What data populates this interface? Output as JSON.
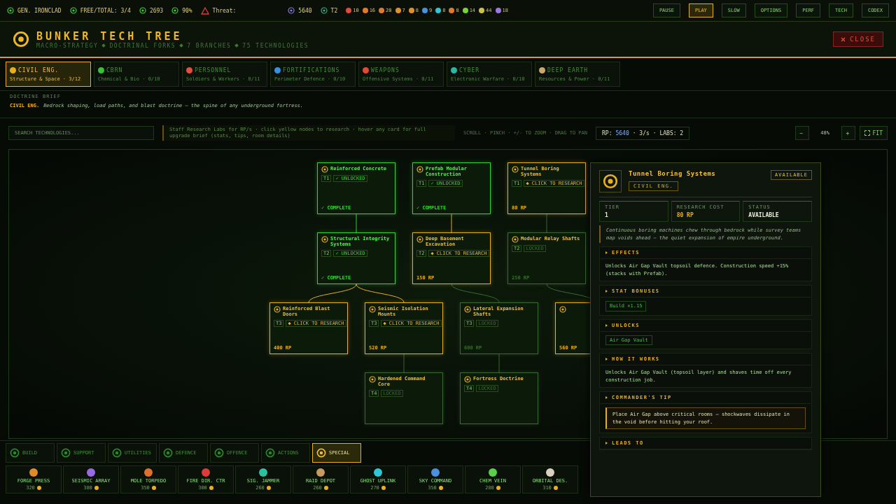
{
  "top_bar": {
    "commander": "GEN. IRONCLAD",
    "workers": "FREE/TOTAL: 3/4",
    "supplies": "2693",
    "power": "90%",
    "threat": "Threat:",
    "research_points": "5640",
    "tier": "T2",
    "resources": [
      {
        "value": "10",
        "color": "#e04a3a"
      },
      {
        "value": "16",
        "color": "#e07a2a"
      },
      {
        "value": "20",
        "color": "#e07a2a"
      },
      {
        "value": "7",
        "color": "#e0902a"
      },
      {
        "value": "8",
        "color": "#e0902a"
      },
      {
        "value": "9",
        "color": "#4a90e0"
      },
      {
        "value": "8",
        "color": "#2ac8d0"
      },
      {
        "value": "8",
        "color": "#e07a2a"
      },
      {
        "value": "14",
        "color": "#7ad03a"
      },
      {
        "value": "44",
        "color": "#d0c04a"
      },
      {
        "value": "18",
        "color": "#9a7ae0"
      }
    ],
    "speed_buttons": [
      {
        "label": "PAUSE",
        "selected": false
      },
      {
        "label": "PLAY",
        "selected": true
      },
      {
        "label": "SLOW",
        "selected": false
      }
    ],
    "menu_buttons": [
      "OPTIONS",
      "PERF",
      "TECH",
      "CODEX"
    ]
  },
  "header": {
    "title": "BUNKER TECH TREE",
    "subtitle": [
      "MACRO-STRATEGY",
      "DOCTRINAL FORKS",
      "7 BRANCHES",
      "75 TECHNOLOGIES"
    ],
    "close": "CLOSE"
  },
  "branches": [
    {
      "name": "CIVIL ENG.",
      "sub": "Structure & Space · 3/12",
      "color": "#e8b020",
      "selected": true
    },
    {
      "name": "CBRN",
      "sub": "Chemical & Bio · 0/10",
      "color": "#3ac03a",
      "selected": false
    },
    {
      "name": "PERSONNEL",
      "sub": "Soldiers & Workers · 0/11",
      "color": "#e05040",
      "selected": false
    },
    {
      "name": "FORTIFICATIONS",
      "sub": "Perimeter Defence · 0/10",
      "color": "#3a90e0",
      "selected": false
    },
    {
      "name": "WEAPONS",
      "sub": "Offensive Systems · 0/11",
      "color": "#e04a3a",
      "selected": false
    },
    {
      "name": "CYBER",
      "sub": "Electronic Warfare · 0/10",
      "color": "#2ab8a0",
      "selected": false
    },
    {
      "name": "DEEP EARTH",
      "sub": "Resources & Power · 0/11",
      "color": "#c8a870",
      "selected": false
    }
  ],
  "brief": {
    "label": "DOCTRINE BRIEF",
    "branch": "CIVIL ENG.",
    "text": "Bedrock shaping, load paths, and blast doctrine — the spine of any underground fortress."
  },
  "toolbar": {
    "search_placeholder": "SEARCH TECHNOLOGIES...",
    "hint": "Staff Research Labs for RP/s · click yellow nodes to research · hover any card for full upgrade brief (stats, tips, room details)",
    "controls": "SCROLL · PINCH · +/- TO ZOOM · DRAG TO PAN",
    "rp_label": "RP:",
    "rp_value": "5640",
    "rp_rate": "· 3/s ·",
    "labs": "LABS: 2",
    "zoom_out": "−",
    "zoom": "48%",
    "zoom_in": "+",
    "fit": "FIT"
  },
  "tree": {
    "tiers": [
      [
        {
          "kind": "researched",
          "title": "Reinforced Concrete",
          "tier": "T1",
          "tag": "✓ UNLOCKED",
          "footer": "✓ COMPLETE"
        },
        {
          "kind": "researched",
          "title": "Prefab Modular Construction",
          "tier": "T1",
          "tag": "✓ UNLOCKED",
          "footer": "✓ COMPLETE"
        },
        {
          "kind": "available",
          "title": "Tunnel Boring Systems",
          "tier": "T1",
          "tag": "◆ CLICK TO RESEARCH",
          "footer": "80 RP"
        }
      ],
      [
        {
          "kind": "researched",
          "title": "Structural Integrity Systems",
          "tier": "T2",
          "tag": "✓ UNLOCKED",
          "footer": "✓ COMPLETE"
        },
        {
          "kind": "available",
          "title": "Deep Basement Excavation",
          "tier": "T2",
          "tag": "◆ CLICK TO RESEARCH",
          "footer": "150 RP"
        },
        {
          "kind": "locked",
          "title": "Modular Relay Shafts",
          "tier": "T2",
          "tag": "LOCKED",
          "footer": "250 RP"
        }
      ],
      [
        {
          "kind": "available",
          "title": "Reinforced Blast Doors",
          "tier": "T3",
          "tag": "◆ CLICK TO RESEARCH",
          "footer": "400 RP"
        },
        {
          "kind": "available",
          "title": "Seismic Isolation Mounts",
          "tier": "T3",
          "tag": "◆ CLICK TO RESEARCH",
          "footer": "520 RP"
        },
        {
          "kind": "locked",
          "title": "Lateral Expansion Shafts",
          "tier": "T3",
          "tag": "LOCKED",
          "footer": "600 RP"
        },
        {
          "kind": "available",
          "footer": "560 RP"
        }
      ],
      [
        {
          "kind": "locked",
          "title": "Hardened Command Core",
          "tier": "T4",
          "tag": "LOCKED"
        },
        {
          "kind": "locked",
          "title": "Fortress Doctrine",
          "tier": "T4",
          "tag": "LOCKED"
        }
      ]
    ]
  },
  "detail": {
    "title": "Tunnel Boring Systems",
    "branch": "CIVIL ENG.",
    "badge": "AVAILABLE",
    "stats": [
      {
        "label": "TIER",
        "value": "1"
      },
      {
        "label": "RESEARCH COST",
        "value": "80 RP"
      },
      {
        "label": "STATUS",
        "value": "AVAILABLE"
      }
    ],
    "quote": "Continuous boring machines chew through bedrock while survey teams map voids ahead — the quiet expansion of empire underground.",
    "sections": [
      {
        "kind": "text",
        "title": "EFFECTS",
        "text": "Unlocks Air Gap Vault topsoil defence. Construction speed +15% (stacks with Prefab)."
      },
      {
        "kind": "chips",
        "title": "STAT BONUSES",
        "chips": [
          "Build ×1.15"
        ]
      },
      {
        "kind": "chips",
        "title": "UNLOCKS",
        "chips": [
          "Air Gap Vault"
        ]
      },
      {
        "kind": "text",
        "title": "HOW IT WORKS",
        "text": "Unlocks Air Gap Vault (topsoil layer) and shaves time off every construction job."
      },
      {
        "kind": "tip",
        "title": "COMMANDER'S TIP",
        "text": "Place Air Gap above critical rooms — shockwaves dissipate in the void before hitting your roof."
      },
      {
        "kind": "header",
        "title": "LEADS TO"
      }
    ]
  },
  "build_tabs": [
    {
      "label": "BUILD",
      "selected": false
    },
    {
      "label": "SUPPORT",
      "selected": false
    },
    {
      "label": "UTILITIES",
      "selected": false
    },
    {
      "label": "DEFENCE",
      "selected": false
    },
    {
      "label": "OFFENCE",
      "selected": false
    },
    {
      "label": "ACTIONS",
      "selected": false
    },
    {
      "label": "SPECIAL",
      "selected": true
    }
  ],
  "build_items": [
    {
      "name": "FORGE PRESS",
      "cost": "320",
      "color": "#e08a2a"
    },
    {
      "name": "SEISMIC ARRAY",
      "cost": "380",
      "color": "#9a6ae0"
    },
    {
      "name": "MOLE TORPEDO",
      "cost": "350",
      "color": "#e0702a"
    },
    {
      "name": "FIRE DIR. CTR",
      "cost": "300",
      "color": "#e03a3a"
    },
    {
      "name": "SIG. JAMMER",
      "cost": "260",
      "color": "#2ac0a0"
    },
    {
      "name": "RAID DEPOT",
      "cost": "260",
      "color": "#c89a60"
    },
    {
      "name": "GHOST UPLINK",
      "cost": "270",
      "color": "#2ac8d8"
    },
    {
      "name": "SKY COMMAND",
      "cost": "350",
      "color": "#4a90e0"
    },
    {
      "name": "CHEM VEIN",
      "cost": "280",
      "color": "#5ad04a"
    },
    {
      "name": "ORBITAL DES.",
      "cost": "310",
      "color": "#d8d0c0"
    }
  ]
}
